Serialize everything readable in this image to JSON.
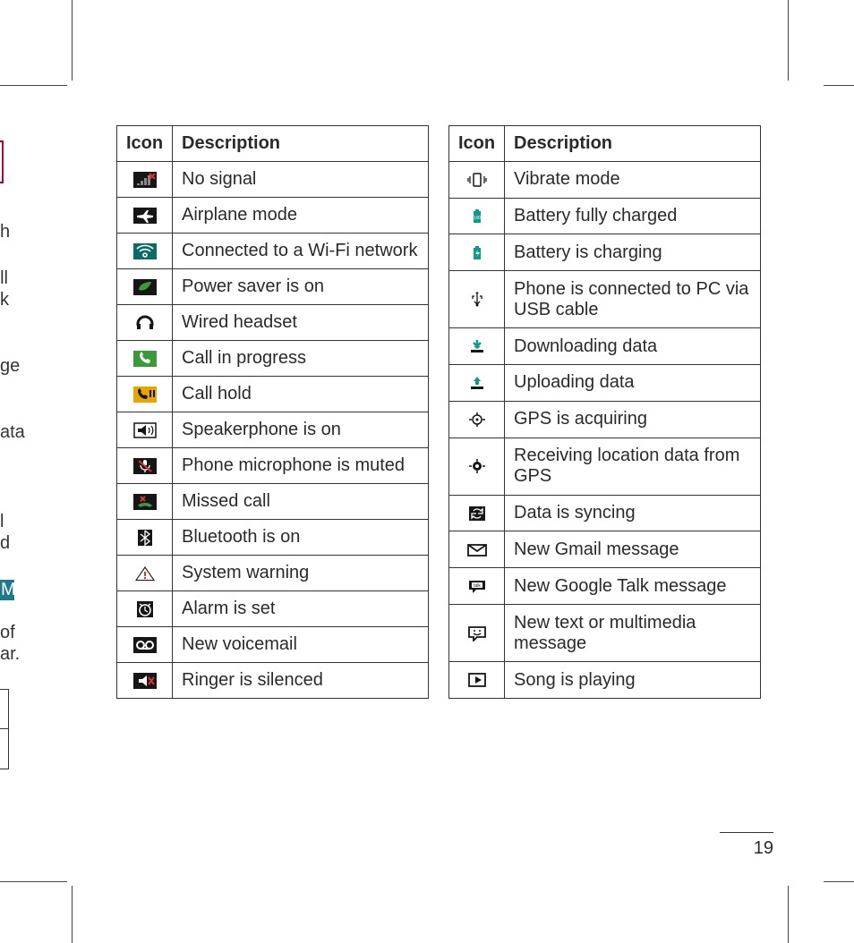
{
  "page_number": "19",
  "headers": {
    "icon": "Icon",
    "description": "Description"
  },
  "table_left": [
    {
      "icon": "no-signal-icon",
      "desc": "No signal"
    },
    {
      "icon": "airplane-mode-icon",
      "desc": "Airplane mode"
    },
    {
      "icon": "wifi-icon",
      "desc": "Connected to a Wi-Fi network"
    },
    {
      "icon": "power-saver-icon",
      "desc": "Power saver is on"
    },
    {
      "icon": "headset-icon",
      "desc": "Wired headset"
    },
    {
      "icon": "call-progress-icon",
      "desc": "Call in progress"
    },
    {
      "icon": "call-hold-icon",
      "desc": "Call hold"
    },
    {
      "icon": "speakerphone-icon",
      "desc": "Speakerphone is on"
    },
    {
      "icon": "mic-muted-icon",
      "desc": "Phone microphone is muted"
    },
    {
      "icon": "missed-call-icon",
      "desc": "Missed call"
    },
    {
      "icon": "bluetooth-icon",
      "desc": "Bluetooth is on"
    },
    {
      "icon": "system-warning-icon",
      "desc": "System warning"
    },
    {
      "icon": "alarm-set-icon",
      "desc": "Alarm is set"
    },
    {
      "icon": "voicemail-icon",
      "desc": "New voicemail"
    },
    {
      "icon": "ringer-silenced-icon",
      "desc": "Ringer is silenced"
    }
  ],
  "table_right": [
    {
      "icon": "vibrate-mode-icon",
      "desc": "Vibrate mode"
    },
    {
      "icon": "battery-full-icon",
      "desc": "Battery fully charged"
    },
    {
      "icon": "battery-charging-icon",
      "desc": "Battery is charging"
    },
    {
      "icon": "usb-connected-icon",
      "desc": "Phone is connected to PC via USB cable"
    },
    {
      "icon": "downloading-icon",
      "desc": "Downloading data"
    },
    {
      "icon": "uploading-icon",
      "desc": "Uploading data"
    },
    {
      "icon": "gps-acquiring-icon",
      "desc": "GPS is acquiring"
    },
    {
      "icon": "gps-receiving-icon",
      "desc": "Receiving location data from GPS"
    },
    {
      "icon": "sync-icon",
      "desc": "Data is syncing"
    },
    {
      "icon": "gmail-icon",
      "desc": "New Gmail message"
    },
    {
      "icon": "google-talk-icon",
      "desc": "New Google Talk message"
    },
    {
      "icon": "mms-sms-icon",
      "desc": "New text or multimedia message"
    },
    {
      "icon": "music-playing-icon",
      "desc": "Song is playing"
    }
  ],
  "fragments": {
    "f1": "h",
    "f2": "ll",
    "f3": "k",
    "f4": "ge",
    "f5": "ata",
    "f6": "l",
    "f7": "d",
    "f8": "M",
    "f9": "of",
    "f10": "ar."
  }
}
